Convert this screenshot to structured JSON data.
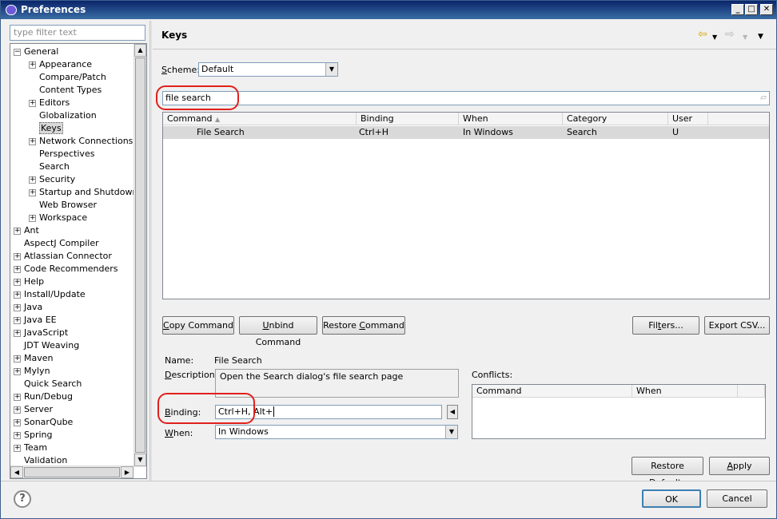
{
  "window": {
    "title": "Preferences",
    "controls": {
      "minimize": "_",
      "maximize": "□",
      "close": "✕"
    }
  },
  "left": {
    "filter_placeholder": "type filter text",
    "tree": [
      {
        "label": "General",
        "level": 0,
        "state": "expanded"
      },
      {
        "label": "Appearance",
        "level": 1,
        "state": "collapsed"
      },
      {
        "label": "Compare/Patch",
        "level": 1,
        "state": "leaf"
      },
      {
        "label": "Content Types",
        "level": 1,
        "state": "leaf"
      },
      {
        "label": "Editors",
        "level": 1,
        "state": "collapsed"
      },
      {
        "label": "Globalization",
        "level": 1,
        "state": "leaf"
      },
      {
        "label": "Keys",
        "level": 1,
        "state": "leaf",
        "selected": true
      },
      {
        "label": "Network Connections",
        "level": 1,
        "state": "collapsed"
      },
      {
        "label": "Perspectives",
        "level": 1,
        "state": "leaf"
      },
      {
        "label": "Search",
        "level": 1,
        "state": "leaf"
      },
      {
        "label": "Security",
        "level": 1,
        "state": "collapsed"
      },
      {
        "label": "Startup and Shutdown",
        "level": 1,
        "state": "collapsed"
      },
      {
        "label": "Web Browser",
        "level": 1,
        "state": "leaf"
      },
      {
        "label": "Workspace",
        "level": 1,
        "state": "collapsed"
      },
      {
        "label": "Ant",
        "level": 0,
        "state": "collapsed"
      },
      {
        "label": "AspectJ Compiler",
        "level": 0,
        "state": "leaf"
      },
      {
        "label": "Atlassian Connector",
        "level": 0,
        "state": "collapsed"
      },
      {
        "label": "Code Recommenders",
        "level": 0,
        "state": "collapsed"
      },
      {
        "label": "Help",
        "level": 0,
        "state": "collapsed"
      },
      {
        "label": "Install/Update",
        "level": 0,
        "state": "collapsed"
      },
      {
        "label": "Java",
        "level": 0,
        "state": "collapsed"
      },
      {
        "label": "Java EE",
        "level": 0,
        "state": "collapsed"
      },
      {
        "label": "JavaScript",
        "level": 0,
        "state": "collapsed"
      },
      {
        "label": "JDT Weaving",
        "level": 0,
        "state": "leaf"
      },
      {
        "label": "Maven",
        "level": 0,
        "state": "collapsed"
      },
      {
        "label": "Mylyn",
        "level": 0,
        "state": "collapsed"
      },
      {
        "label": "Quick Search",
        "level": 0,
        "state": "leaf"
      },
      {
        "label": "Run/Debug",
        "level": 0,
        "state": "collapsed"
      },
      {
        "label": "Server",
        "level": 0,
        "state": "collapsed"
      },
      {
        "label": "SonarQube",
        "level": 0,
        "state": "collapsed"
      },
      {
        "label": "Spring",
        "level": 0,
        "state": "collapsed"
      },
      {
        "label": "Team",
        "level": 0,
        "state": "collapsed"
      },
      {
        "label": "Validation",
        "level": 0,
        "state": "leaf"
      }
    ]
  },
  "page": {
    "title": "Keys",
    "scheme_label_underlined": "S",
    "scheme_label_rest": "cheme:",
    "scheme_value": "Default",
    "search_value": "file search",
    "columns": [
      "Command",
      "Binding",
      "When",
      "Category",
      "User"
    ],
    "rows": [
      {
        "command": "File Search",
        "binding": "Ctrl+H",
        "when": "In Windows",
        "category": "Search",
        "user": "U"
      }
    ],
    "buttons": {
      "copy_u": "C",
      "copy_rest": "opy Command",
      "unbind_u": "U",
      "unbind_rest": "nbind Command",
      "restore_pre": "Restore ",
      "restore_u": "C",
      "restore_rest": "ommand",
      "filters_pre": "Fil",
      "filters_u": "t",
      "filters_rest": "ers...",
      "export": "Export CSV...",
      "restore_defaults_pre": "Restore ",
      "restore_defaults_u": "D",
      "restore_defaults_rest": "efaults",
      "apply_u": "A",
      "apply_rest": "pply"
    },
    "details": {
      "name_label": "Name:",
      "name_value": "File Search",
      "description_label_pre": "D",
      "description_label_rest": "escription:",
      "description_value": "Open the Search dialog's file search page",
      "binding_label_u": "B",
      "binding_label_rest": "inding:",
      "binding_value": "Ctrl+H, Alt+",
      "when_label_u": "W",
      "when_label_rest": "hen:",
      "when_value": "In Windows",
      "conflicts_label": "Conflicts:",
      "conflicts_columns": [
        "Command",
        "When"
      ]
    }
  },
  "footer": {
    "help": "?",
    "ok": "OK",
    "cancel": "Cancel"
  },
  "colors": {
    "callout": "#e0201b",
    "selection": "#d9d9d9",
    "titlebar": "#0a246a"
  }
}
